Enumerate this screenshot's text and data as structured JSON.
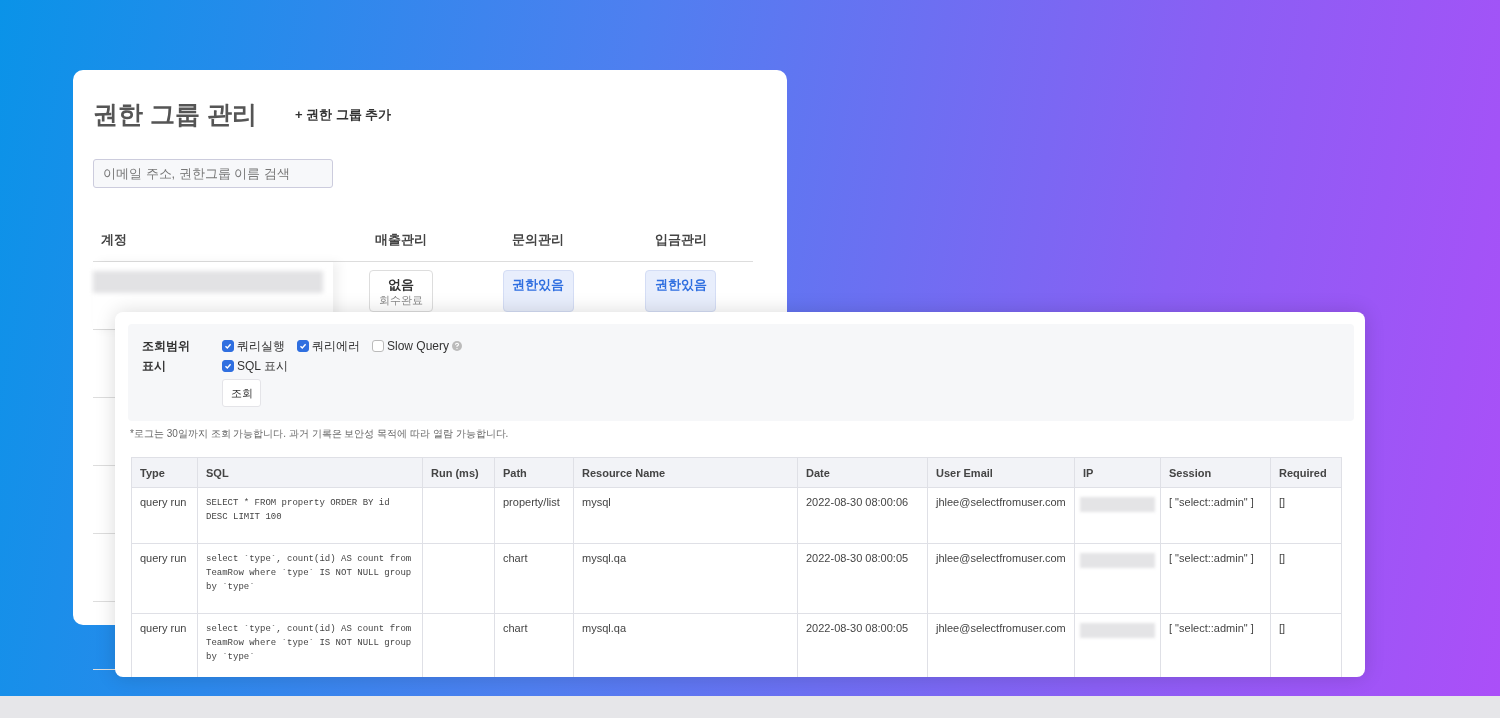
{
  "permission_groups": {
    "title": "권한 그룹 관리",
    "add_button": "+ 권한 그룹 추가",
    "search": {
      "placeholder": "이메일 주소, 권한그룹 이름 검색"
    },
    "columns": [
      "계정",
      "매출관리",
      "문의관리",
      "입금관리"
    ],
    "rows": [
      {
        "cells": [
          {
            "kind": "redacted"
          },
          {
            "kind": "none",
            "label": "없음",
            "sublabel": "회수완료"
          },
          {
            "kind": "granted",
            "label": "권한있음"
          },
          {
            "kind": "granted",
            "label": "권한있음"
          }
        ]
      }
    ]
  },
  "query_log": {
    "filters": [
      {
        "label": "조회범위",
        "options": [
          {
            "label": "쿼리실행",
            "checked": true
          },
          {
            "label": "쿼리에러",
            "checked": true
          },
          {
            "label": "Slow Query",
            "checked": false,
            "help": true
          }
        ]
      },
      {
        "label": "표시",
        "options": [
          {
            "label": "SQL 표시",
            "checked": true
          }
        ]
      }
    ],
    "search_button": "조회",
    "note": "*로그는 30일까지 조회 가능합니다. 과거 기록은 보안성 목적에 따라 열람 가능합니다.",
    "table": {
      "columns": [
        "Type",
        "SQL",
        "Run (ms)",
        "Path",
        "Resource Name",
        "Date",
        "User Email",
        "IP",
        "Session",
        "Required"
      ],
      "rows": [
        {
          "type": "query run",
          "sql": "SELECT * FROM property ORDER BY id DESC LIMIT 100",
          "path": "property/list",
          "resource_name": "mysql",
          "date": "2022-08-30 08:00:06",
          "user_email": "jhlee@selectfromuser.com",
          "ip_redacted": true,
          "session": "[ \"select::admin\" ]",
          "required": "[]"
        },
        {
          "type": "query run",
          "sql": "select `type`, count(id) AS count from TeamRow where `type` IS NOT NULL group by `type`",
          "path": "chart",
          "resource_name": "mysql.qa",
          "date": "2022-08-30 08:00:05",
          "user_email": "jhlee@selectfromuser.com",
          "ip_redacted": true,
          "session": "[ \"select::admin\" ]",
          "required": "[]"
        },
        {
          "type": "query run",
          "sql": "select `type`, count(id) AS count from TeamRow where `type` IS NOT NULL group by `type`",
          "path": "chart",
          "resource_name": "mysql.qa",
          "date": "2022-08-30 08:00:05",
          "user_email": "jhlee@selectfromuser.com",
          "ip_redacted": true,
          "session": "[ \"select::admin\" ]",
          "required": "[]"
        }
      ]
    }
  }
}
